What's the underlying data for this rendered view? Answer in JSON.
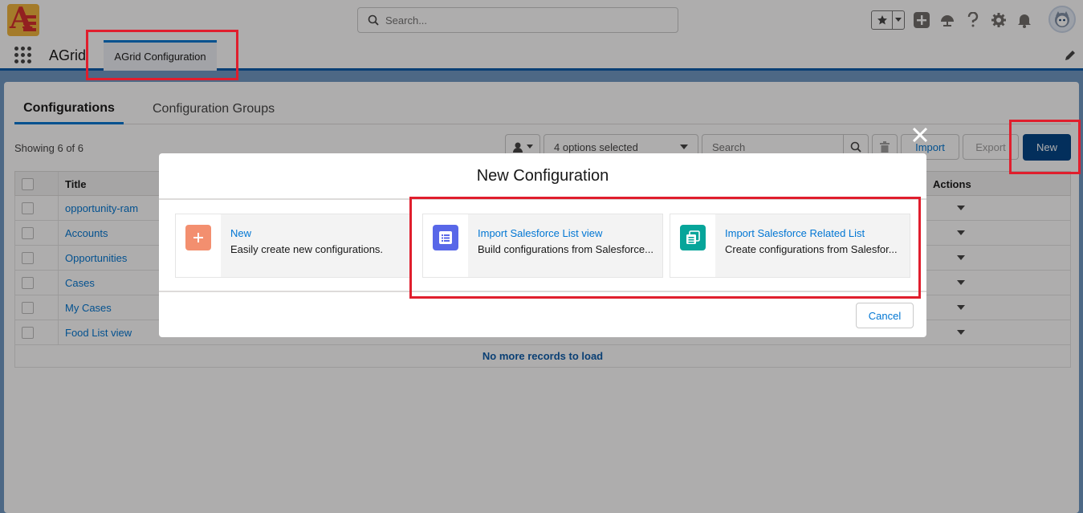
{
  "header": {
    "search_placeholder": "Search..."
  },
  "nav": {
    "app_name": "AGrid",
    "active_tab": "AGrid Configuration"
  },
  "tabs": [
    {
      "label": "Configurations",
      "active": true
    },
    {
      "label": "Configuration Groups",
      "active": false
    }
  ],
  "list": {
    "showing": "Showing 6 of 6",
    "options_selected": "4 options selected",
    "search_placeholder": "Search",
    "import_label": "Import",
    "export_label": "Export",
    "new_label": "New",
    "columns": {
      "title": "Title",
      "actions": "Actions"
    },
    "rows": [
      {
        "title": "opportunity-ram"
      },
      {
        "title": "Accounts"
      },
      {
        "title": "Opportunities"
      },
      {
        "title": "Cases"
      },
      {
        "title": "My Cases"
      },
      {
        "title": "Food List view"
      }
    ],
    "load_more": "No more records to load"
  },
  "modal": {
    "title": "New Configuration",
    "options": [
      {
        "title": "New",
        "description": "Easily create new configurations.",
        "icon": "plus-icon",
        "color": "#f38f6f"
      },
      {
        "title": "Import Salesforce List view",
        "description": "Build configurations from Salesforce...",
        "icon": "list-icon",
        "color": "#5867e8"
      },
      {
        "title": "Import Salesforce Related List",
        "description": "Create configurations from Salesfor...",
        "icon": "related-list-icon",
        "color": "#0d9dda"
      }
    ],
    "cancel_label": "Cancel"
  },
  "colors": {
    "brand": "#0176d3",
    "primary_button": "#014486",
    "annotation": "#e01e2d"
  }
}
